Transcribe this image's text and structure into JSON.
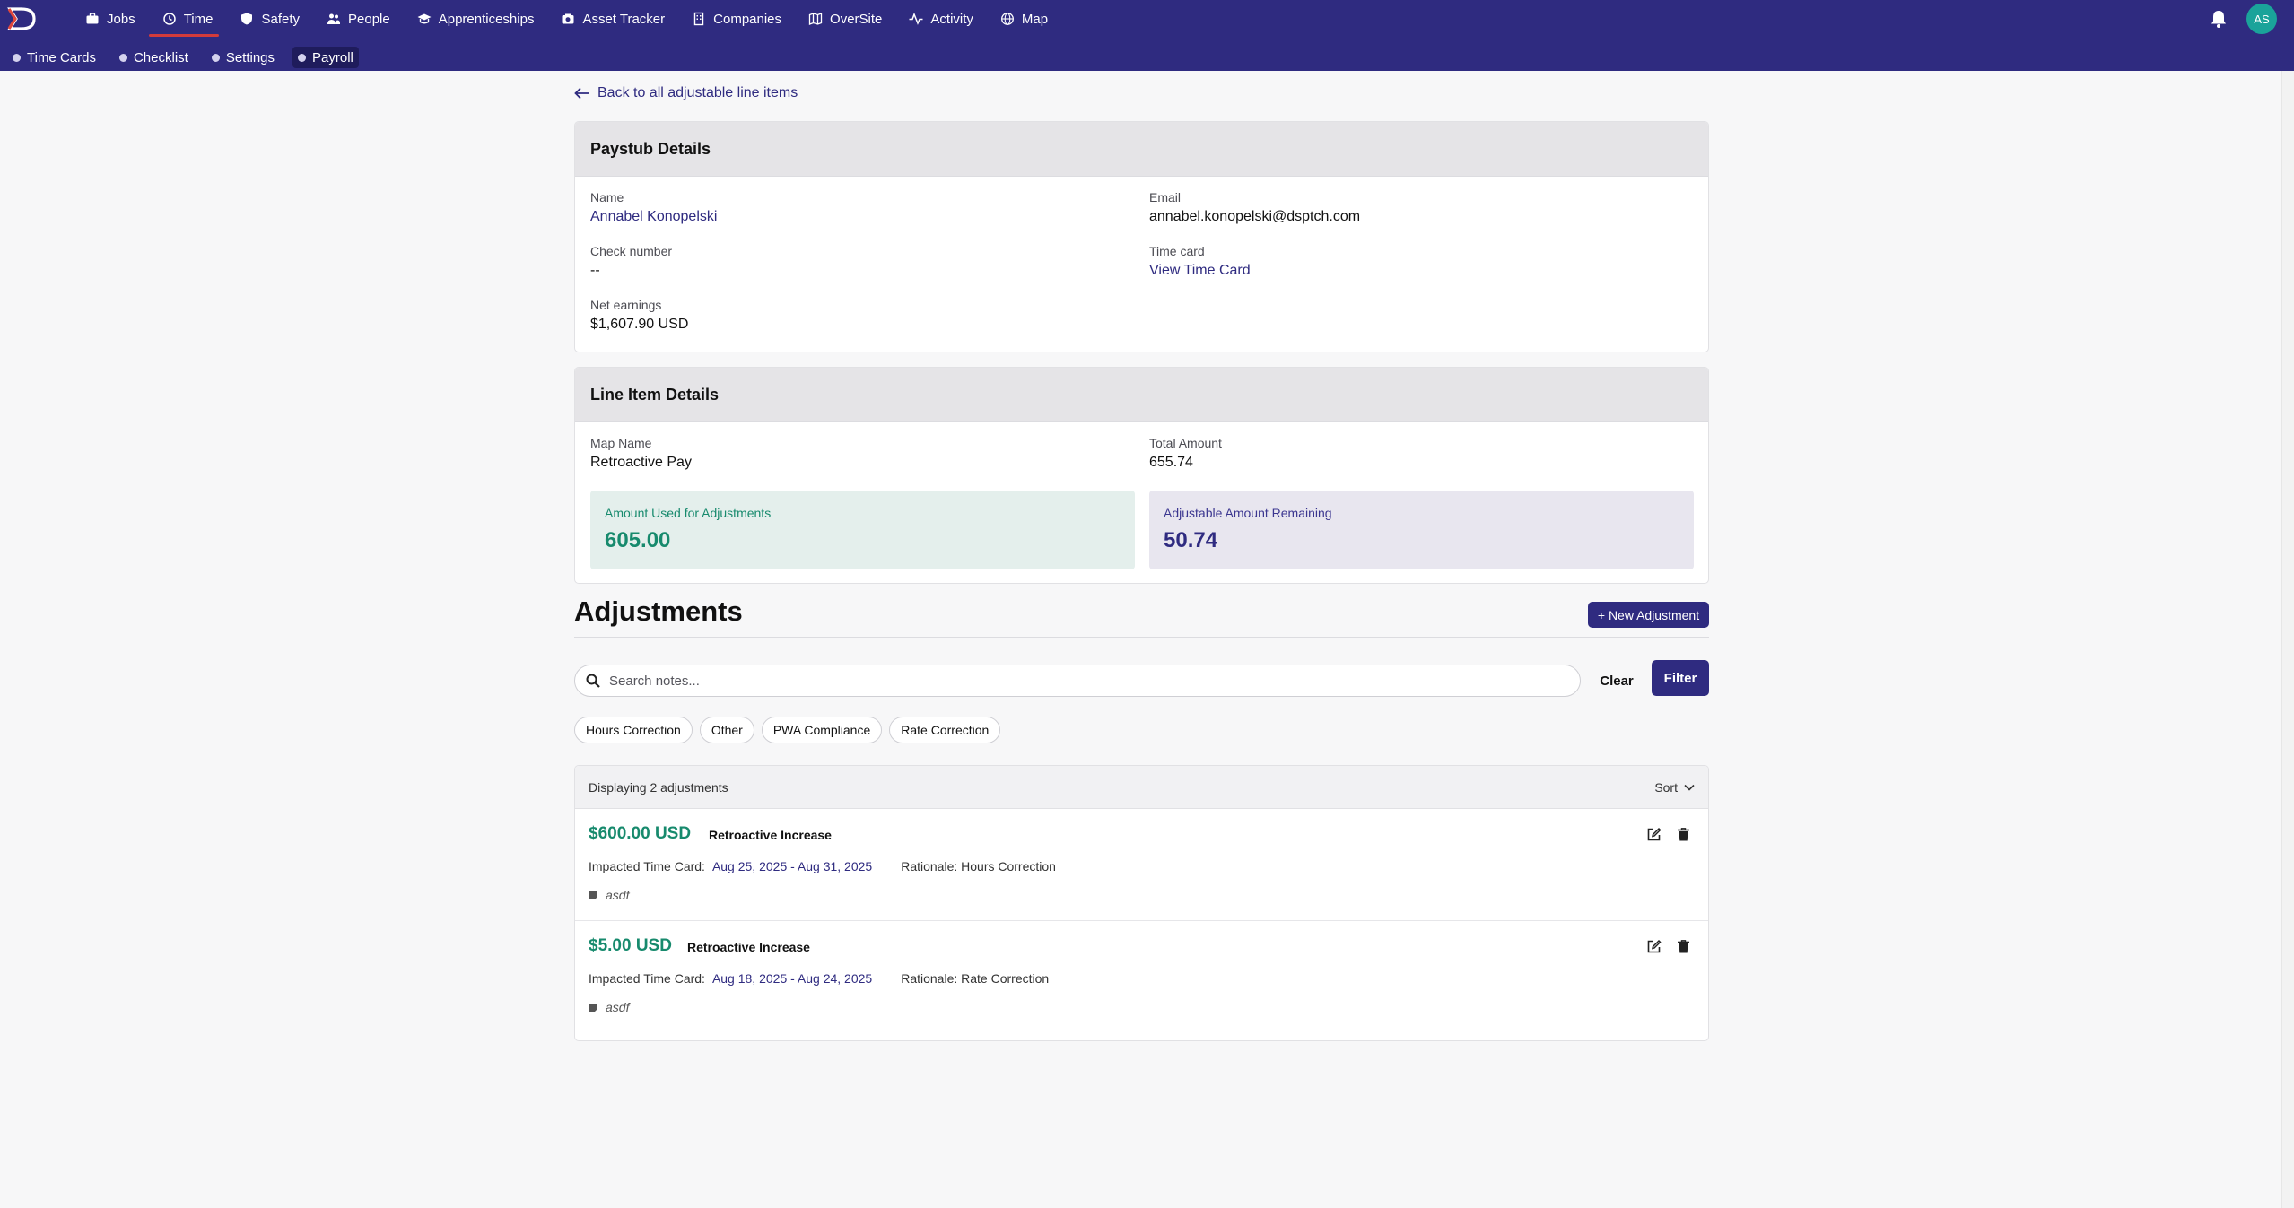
{
  "nav": {
    "items": [
      {
        "label": "Jobs",
        "icon": "briefcase-icon"
      },
      {
        "label": "Time",
        "icon": "clock-icon"
      },
      {
        "label": "Safety",
        "icon": "shield-icon"
      },
      {
        "label": "People",
        "icon": "people-icon"
      },
      {
        "label": "Apprenticeships",
        "icon": "graduation-cap-icon"
      },
      {
        "label": "Asset Tracker",
        "icon": "camera-icon"
      },
      {
        "label": "Companies",
        "icon": "building-icon"
      },
      {
        "label": "OverSite",
        "icon": "map-fold-icon"
      },
      {
        "label": "Activity",
        "icon": "activity-icon"
      },
      {
        "label": "Map",
        "icon": "globe-icon"
      }
    ],
    "active": "Time",
    "avatar_initials": "AS"
  },
  "subnav": {
    "items": [
      {
        "label": "Time Cards"
      },
      {
        "label": "Checklist"
      },
      {
        "label": "Settings"
      },
      {
        "label": "Payroll"
      }
    ],
    "active": "Payroll"
  },
  "back_link": "Back to all adjustable line items",
  "paystub": {
    "title": "Paystub Details",
    "name_label": "Name",
    "name": "Annabel Konopelski",
    "email_label": "Email",
    "email": "annabel.konopelski@dsptch.com",
    "check_label": "Check number",
    "check": "--",
    "timecard_label": "Time card",
    "timecard": "View Time Card",
    "net_label": "Net earnings",
    "net": "$1,607.90 USD"
  },
  "line_item": {
    "title": "Line Item Details",
    "map_label": "Map Name",
    "map_name": "Retroactive Pay",
    "total_label": "Total Amount",
    "total": "655.74",
    "used_label": "Amount Used for Adjustments",
    "used": "605.00",
    "remaining_label": "Adjustable Amount Remaining",
    "remaining": "50.74"
  },
  "adjustments": {
    "title": "Adjustments",
    "new_button": "+ New Adjustment",
    "search_placeholder": "Search notes...",
    "clear": "Clear",
    "filter": "Filter",
    "chips": [
      "Hours Correction",
      "Other",
      "PWA Compliance",
      "Rate Correction"
    ],
    "count_text": "Displaying 2 adjustments",
    "sort_label": "Sort",
    "rows": [
      {
        "amount": "$600.00 USD",
        "type": "Retroactive Increase",
        "impacted_label": "Impacted Time Card:",
        "range": "Aug 25, 2025 - Aug 31, 2025",
        "rationale": "Rationale: Hours Correction",
        "note": "asdf"
      },
      {
        "amount": "$5.00 USD",
        "type": "Retroactive Increase",
        "impacted_label": "Impacted Time Card:",
        "range": "Aug 18, 2025 - Aug 24, 2025",
        "rationale": "Rationale: Rate Correction",
        "note": "asdf"
      }
    ]
  },
  "colors": {
    "brand": "#2f2b80",
    "accent_red": "#d33b3b",
    "green": "#178a6d",
    "avatar": "#1aa39a"
  }
}
